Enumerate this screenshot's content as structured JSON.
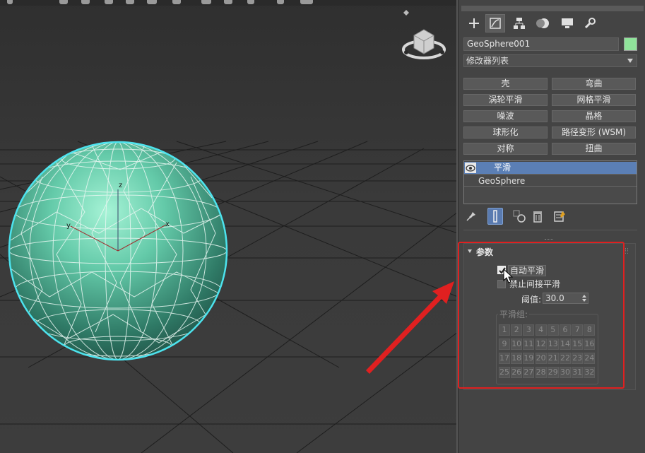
{
  "panel": {
    "tabs": [
      {
        "name": "create-tab",
        "icon": "plus-icon"
      },
      {
        "name": "modify-tab",
        "icon": "modify-icon"
      },
      {
        "name": "hierarchy-tab",
        "icon": "hierarchy-icon"
      },
      {
        "name": "motion-tab",
        "icon": "motion-icon"
      },
      {
        "name": "display-tab",
        "icon": "display-icon"
      },
      {
        "name": "utilities-tab",
        "icon": "wrench-icon"
      }
    ],
    "object_name": "GeoSphere001",
    "object_color": "#8fe39a",
    "modifier_list": "修改器列表",
    "modifier_buttons": [
      [
        "壳",
        "弯曲"
      ],
      [
        "涡轮平滑",
        "网格平滑"
      ],
      [
        "噪波",
        "晶格"
      ],
      [
        "球形化",
        "路径变形 (WSM)"
      ],
      [
        "对称",
        "扭曲"
      ]
    ],
    "stack": {
      "items": [
        "平滑",
        "GeoSphere"
      ]
    },
    "rollout": {
      "title": "参数",
      "auto_smooth_label": "自动平滑",
      "auto_smooth_checked": true,
      "prevent_indirect_label": "禁止间接平滑",
      "prevent_indirect_checked": false,
      "threshold_label": "阈值:",
      "threshold_value": "30.0",
      "smoothing_groups_label": "平滑组:",
      "smoothing_groups": [
        "1",
        "2",
        "3",
        "4",
        "5",
        "6",
        "7",
        "8",
        "9",
        "10",
        "11",
        "12",
        "13",
        "14",
        "15",
        "16",
        "17",
        "18",
        "19",
        "20",
        "21",
        "22",
        "23",
        "24",
        "25",
        "26",
        "27",
        "28",
        "29",
        "30",
        "31",
        "32"
      ]
    }
  },
  "viewport": {
    "axes": {
      "z": "z",
      "y": "y",
      "x": "x"
    }
  },
  "colors": {
    "highlight": "#5b7fb5",
    "annotation_red": "#e02020",
    "sphere": "#5fcfae"
  }
}
